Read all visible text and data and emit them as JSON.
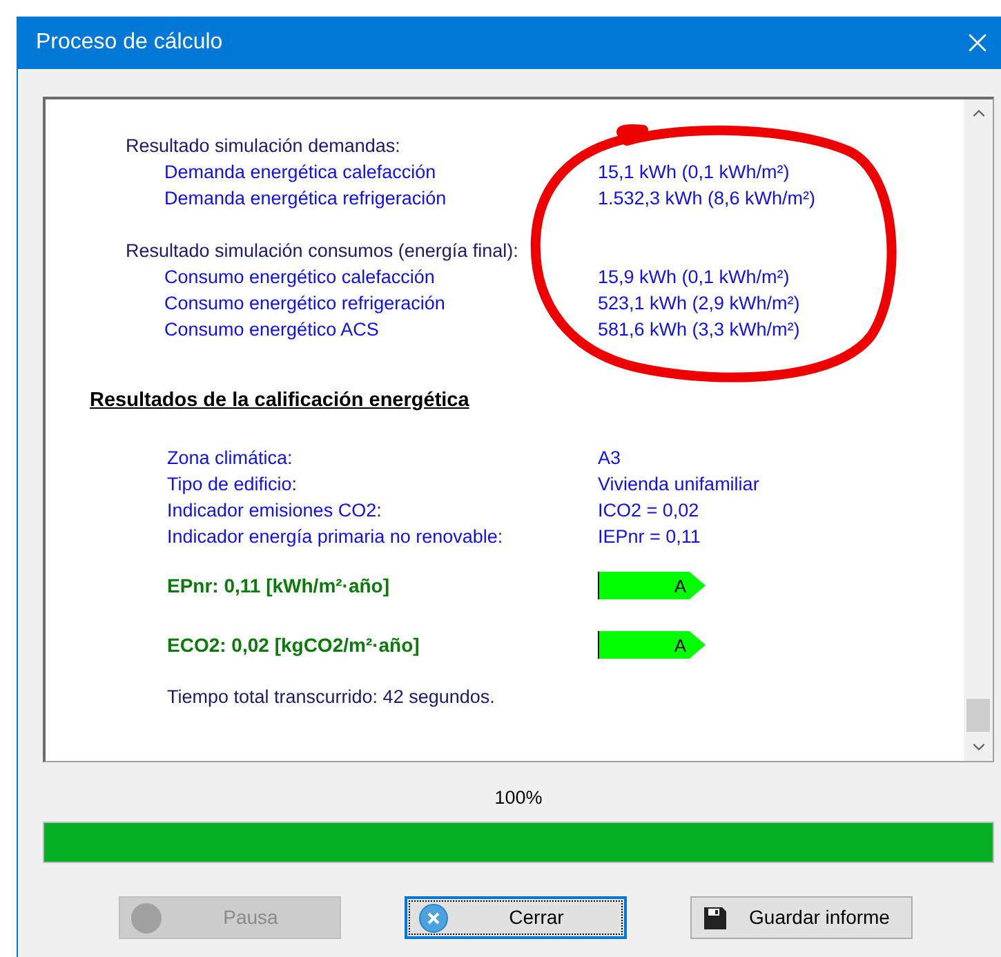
{
  "window": {
    "title": "Proceso de cálculo"
  },
  "results": [
    {
      "heading": "Resultado simulación demandas:",
      "rows": [
        {
          "label": "Demanda energética calefacción",
          "value": "15,1 kWh (0,1 kWh/m²)"
        },
        {
          "label": "Demanda energética refrigeración",
          "value": "1.532,3 kWh (8,6 kWh/m²)"
        }
      ]
    },
    {
      "heading": "Resultado simulación consumos (energía final):",
      "rows": [
        {
          "label": "Consumo energético calefacción",
          "value": "15,9 kWh (0,1 kWh/m²)"
        },
        {
          "label": "Consumo energético refrigeración",
          "value": "523,1 kWh (2,9 kWh/m²)"
        },
        {
          "label": "Consumo energético ACS",
          "value": "581,6 kWh (3,3 kWh/m²)"
        }
      ]
    }
  ],
  "rating": {
    "heading": "Resultados de la calificación energética",
    "info": [
      {
        "label": "Zona climática:",
        "value": "A3"
      },
      {
        "label": "Tipo de edificio:",
        "value": "Vivienda unifamiliar"
      },
      {
        "label": "Indicador emisiones CO2:",
        "value": "ICO2 = 0,02"
      },
      {
        "label": "Indicador energía primaria no renovable:",
        "value": "IEPnr = 0,11"
      }
    ],
    "indicators": [
      {
        "label": "EPnr: 0,11 [kWh/m²·año]",
        "grade": "A"
      },
      {
        "label": "ECO2: 0,02 [kgCO2/m²·año]",
        "grade": "A"
      }
    ],
    "elapsed": "Tiempo total transcurrido: 42 segundos."
  },
  "progress": {
    "label": "100%",
    "level": 1
  },
  "buttons": [
    {
      "kind": "pause",
      "label": "Pausa",
      "disabled": true,
      "focused": false
    },
    {
      "kind": "close",
      "label": "Cerrar",
      "disabled": false,
      "focused": true
    },
    {
      "kind": "save",
      "label": "Guardar informe",
      "disabled": false,
      "focused": false
    }
  ]
}
